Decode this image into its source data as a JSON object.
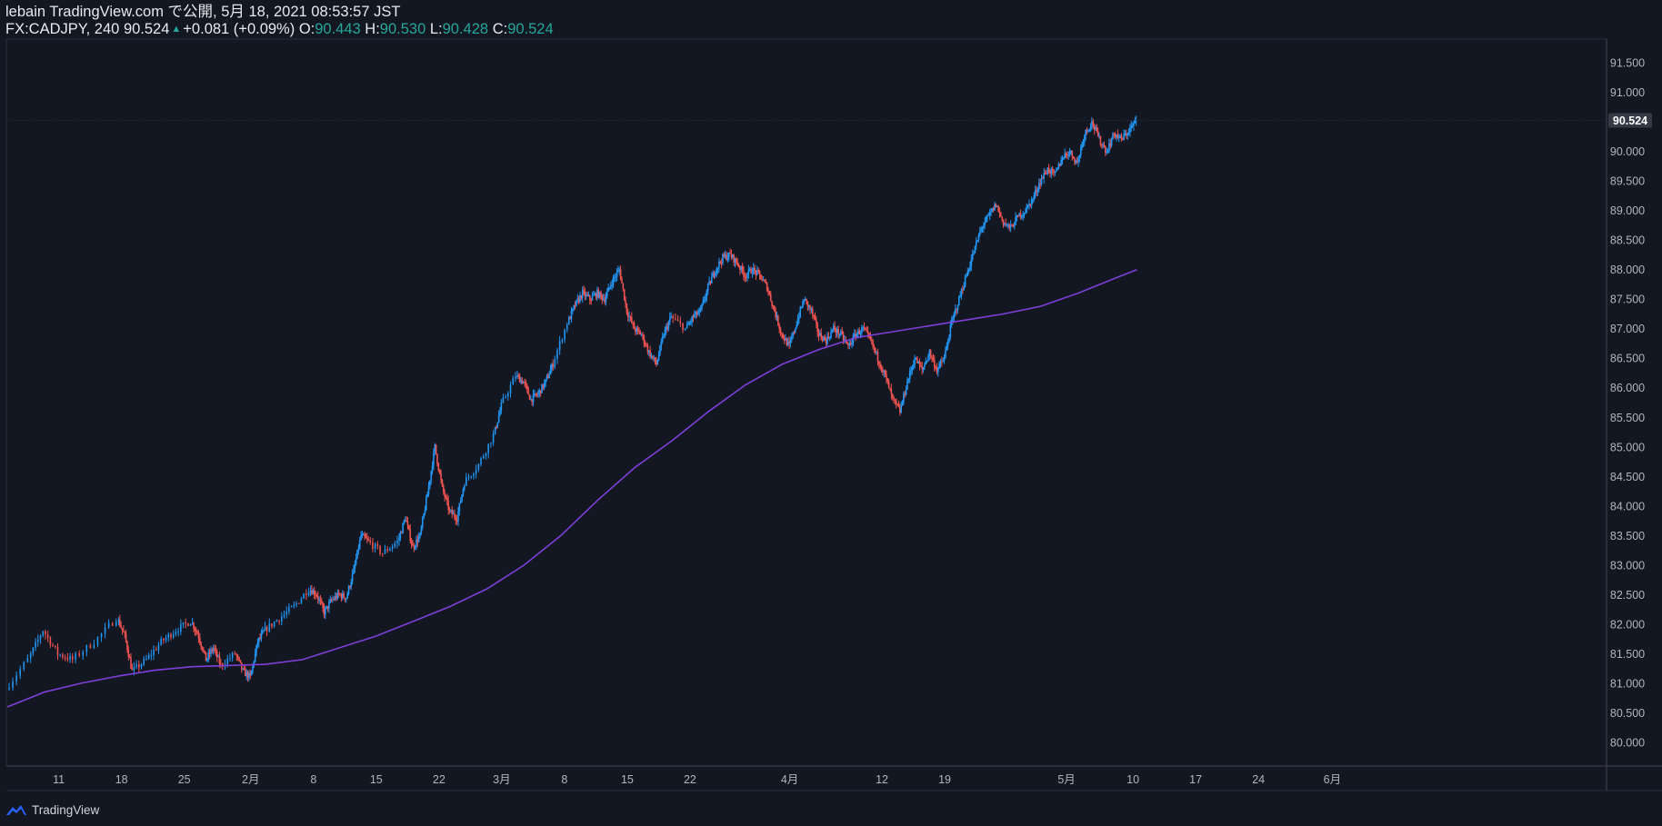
{
  "header": {
    "publish_line": "lebain TradingView.com で公開, 5月 18, 2021 08:53:57 JST",
    "symbol": "FX:CADJPY, 240",
    "last_price": "90.524",
    "change": "+0.081 (+0.09%)",
    "ohlc": {
      "o_label": "O:",
      "o": "90.443",
      "h_label": "H:",
      "h": "90.530",
      "l_label": "L:",
      "l": "90.428",
      "c_label": "C:",
      "c": "90.524"
    }
  },
  "footer": {
    "brand": "TradingView"
  },
  "colors": {
    "background": "#131722",
    "up_candle": "#2196f3",
    "down_candle": "#ef5350",
    "moving_average": "#7e3fd8",
    "axis_text": "#b2b5be",
    "last_price_tag_bg": "#363a45",
    "change_up": "#26a69a"
  },
  "chart_data": {
    "type": "candlestick",
    "title": "",
    "ylim": [
      79.6,
      91.9
    ],
    "y_ticks": [
      "80.000",
      "80.500",
      "81.000",
      "81.500",
      "82.000",
      "82.500",
      "83.000",
      "83.500",
      "84.000",
      "84.500",
      "85.000",
      "85.500",
      "86.000",
      "86.500",
      "87.000",
      "87.500",
      "88.000",
      "88.500",
      "89.000",
      "89.500",
      "90.000",
      "90.500",
      "91.000",
      "91.500"
    ],
    "x_ticks": [
      "11",
      "18",
      "25",
      "2月",
      "8",
      "15",
      "22",
      "3月",
      "8",
      "15",
      "22",
      "4月",
      "12",
      "19",
      "5月",
      "10",
      "17",
      "24",
      "6月"
    ],
    "last_price_label": "90.524",
    "price_path": [
      [
        0,
        80.9
      ],
      [
        3,
        81.4
      ],
      [
        5,
        81.9
      ],
      [
        7,
        81.5
      ],
      [
        9,
        81.4
      ],
      [
        12,
        81.7
      ],
      [
        15,
        82.1
      ],
      [
        16,
        81.8
      ],
      [
        17,
        81.2
      ],
      [
        19,
        81.4
      ],
      [
        21,
        81.7
      ],
      [
        23,
        81.9
      ],
      [
        25,
        82.05
      ],
      [
        26,
        81.8
      ],
      [
        27,
        81.4
      ],
      [
        28,
        81.6
      ],
      [
        29,
        81.3
      ],
      [
        31,
        81.5
      ],
      [
        32,
        81.2
      ],
      [
        33,
        81.1
      ],
      [
        34,
        81.7
      ],
      [
        35,
        81.9
      ],
      [
        37,
        82.1
      ],
      [
        39,
        82.3
      ],
      [
        41,
        82.6
      ],
      [
        42,
        82.5
      ],
      [
        43,
        82.2
      ],
      [
        44,
        82.4
      ],
      [
        45,
        82.5
      ],
      [
        46,
        82.45
      ],
      [
        47,
        82.9
      ],
      [
        48,
        83.5
      ],
      [
        49,
        83.4
      ],
      [
        51,
        83.2
      ],
      [
        53,
        83.4
      ],
      [
        54,
        83.8
      ],
      [
        55,
        83.3
      ],
      [
        56,
        83.5
      ],
      [
        57,
        84.2
      ],
      [
        58,
        85.0
      ],
      [
        59,
        84.3
      ],
      [
        60,
        83.9
      ],
      [
        61,
        83.8
      ],
      [
        62,
        84.4
      ],
      [
        64,
        84.7
      ],
      [
        66,
        85.2
      ],
      [
        67,
        85.7
      ],
      [
        69,
        86.2
      ],
      [
        70,
        86.1
      ],
      [
        71,
        85.8
      ],
      [
        72,
        85.9
      ],
      [
        73,
        86.1
      ],
      [
        74,
        86.4
      ],
      [
        76,
        87.1
      ],
      [
        77,
        87.4
      ],
      [
        78,
        87.6
      ],
      [
        79,
        87.5
      ],
      [
        80,
        87.6
      ],
      [
        81,
        87.5
      ],
      [
        82,
        87.8
      ],
      [
        83,
        88.0
      ],
      [
        84,
        87.3
      ],
      [
        85,
        87.0
      ],
      [
        86,
        86.9
      ],
      [
        87,
        86.6
      ],
      [
        88,
        86.4
      ],
      [
        89,
        86.9
      ],
      [
        90,
        87.2
      ],
      [
        92,
        87.0
      ],
      [
        93,
        87.2
      ],
      [
        94,
        87.3
      ],
      [
        95,
        87.7
      ],
      [
        96,
        88.0
      ],
      [
        97,
        88.2
      ],
      [
        98,
        88.25
      ],
      [
        99,
        88.1
      ],
      [
        100,
        87.9
      ],
      [
        101,
        88.0
      ],
      [
        102,
        87.9
      ],
      [
        103,
        87.7
      ],
      [
        104,
        87.3
      ],
      [
        105,
        86.9
      ],
      [
        106,
        86.7
      ],
      [
        107,
        87.1
      ],
      [
        108,
        87.5
      ],
      [
        109,
        87.3
      ],
      [
        110,
        86.9
      ],
      [
        111,
        86.8
      ],
      [
        112,
        87.0
      ],
      [
        113,
        86.9
      ],
      [
        114,
        86.7
      ],
      [
        115,
        86.9
      ],
      [
        116,
        87.0
      ],
      [
        117,
        86.8
      ],
      [
        118,
        86.5
      ],
      [
        119,
        86.2
      ],
      [
        120,
        85.8
      ],
      [
        121,
        85.6
      ],
      [
        122,
        86.1
      ],
      [
        123,
        86.5
      ],
      [
        124,
        86.3
      ],
      [
        125,
        86.6
      ],
      [
        126,
        86.3
      ],
      [
        127,
        86.5
      ],
      [
        128,
        87.1
      ],
      [
        129,
        87.5
      ],
      [
        130,
        87.9
      ],
      [
        131,
        88.3
      ],
      [
        132,
        88.7
      ],
      [
        133,
        88.9
      ],
      [
        134,
        89.1
      ],
      [
        135,
        88.8
      ],
      [
        136,
        88.7
      ],
      [
        137,
        88.9
      ],
      [
        138,
        89.0
      ],
      [
        139,
        89.2
      ],
      [
        140,
        89.5
      ],
      [
        141,
        89.7
      ],
      [
        142,
        89.6
      ],
      [
        143,
        89.9
      ],
      [
        144,
        90.0
      ],
      [
        145,
        89.8
      ],
      [
        146,
        90.3
      ],
      [
        147,
        90.5
      ],
      [
        148,
        90.2
      ],
      [
        149,
        90.0
      ],
      [
        150,
        90.3
      ],
      [
        151,
        90.2
      ],
      [
        152,
        90.35
      ],
      [
        153,
        90.524
      ]
    ],
    "series": [
      {
        "name": "",
        "type": "line",
        "points": [
          [
            0,
            80.6
          ],
          [
            5,
            80.85
          ],
          [
            10,
            81.0
          ],
          [
            15,
            81.12
          ],
          [
            20,
            81.22
          ],
          [
            25,
            81.28
          ],
          [
            30,
            81.3
          ],
          [
            35,
            81.32
          ],
          [
            40,
            81.4
          ],
          [
            45,
            81.6
          ],
          [
            50,
            81.8
          ],
          [
            55,
            82.05
          ],
          [
            60,
            82.3
          ],
          [
            65,
            82.6
          ],
          [
            70,
            83.0
          ],
          [
            75,
            83.5
          ],
          [
            80,
            84.1
          ],
          [
            85,
            84.65
          ],
          [
            90,
            85.1
          ],
          [
            95,
            85.6
          ],
          [
            100,
            86.05
          ],
          [
            105,
            86.4
          ],
          [
            110,
            86.65
          ],
          [
            115,
            86.85
          ],
          [
            120,
            86.95
          ],
          [
            125,
            87.05
          ],
          [
            130,
            87.15
          ],
          [
            135,
            87.25
          ],
          [
            140,
            87.38
          ],
          [
            145,
            87.6
          ],
          [
            150,
            87.85
          ],
          [
            153,
            88.0
          ]
        ]
      }
    ]
  }
}
